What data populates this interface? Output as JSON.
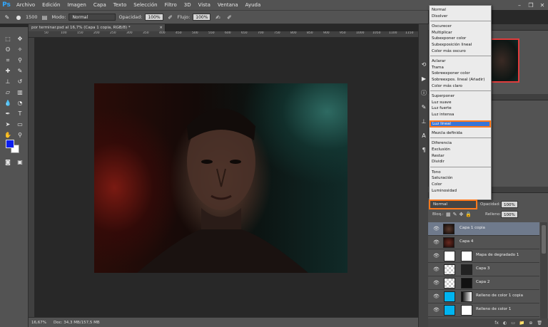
{
  "app": {
    "logo": "Ps"
  },
  "menu": [
    "Archivo",
    "Edición",
    "Imagen",
    "Capa",
    "Texto",
    "Selección",
    "Filtro",
    "3D",
    "Vista",
    "Ventana",
    "Ayuda"
  ],
  "window_controls": [
    "–",
    "❐",
    "✕"
  ],
  "options": {
    "brush_size": "1500",
    "mode_label": "Modo:",
    "mode_value": "Normal",
    "opacity_label": "Opacidad:",
    "opacity_value": "100%",
    "flow_label": "Flujo:",
    "flow_value": "100%"
  },
  "document": {
    "tab_title": "por terminar.psd al 16,7% (Capa 1 copia, RGB/8) *",
    "close": "×",
    "ruler_ticks": [
      "50",
      "100",
      "150",
      "200",
      "250",
      "300",
      "350",
      "400",
      "450",
      "500",
      "550",
      "600",
      "650",
      "700",
      "750",
      "800",
      "850",
      "900",
      "950",
      "1000",
      "1050",
      "1100",
      "1150"
    ]
  },
  "status": {
    "zoom": "16,67%",
    "doc": "Doc: 34,3 MB/157,5 MB"
  },
  "blend_menu": {
    "groups": [
      [
        "Normal",
        "Disolver"
      ],
      [
        "Oscurecer",
        "Multiplicar",
        "Subexponer color",
        "Subexposición lineal",
        "Color más oscuro"
      ],
      [
        "Aclarar",
        "Trama",
        "Sobreexponer color",
        "Sobreexpos. lineal (Añadir)",
        "Color más claro"
      ],
      [
        "Superponer",
        "Luz suave",
        "Luz fuerte",
        "Luz intensa",
        "Luz lineal",
        "Luz focal",
        "Mezcla definida"
      ],
      [
        "Diferencia",
        "Exclusión",
        "Restar",
        "Dividir"
      ],
      [
        "Tono",
        "Saturación",
        "Color",
        "Luminosidad"
      ]
    ],
    "highlighted": "Luz lineal"
  },
  "layers_panel": {
    "blend_mode": "Normal",
    "opacity_label": "Opacidad:",
    "opacity_value": "100%",
    "lock_label": "Bloq.:",
    "fill_label": "Relleno:",
    "fill_value": "100%",
    "layers": [
      {
        "name": "Capa 1 copia",
        "selected": true
      },
      {
        "name": "Capa 4",
        "selected": false
      },
      {
        "name": "Mapa de degradado 1",
        "selected": false
      },
      {
        "name": "Capa 3",
        "selected": false
      },
      {
        "name": "Capa 2",
        "selected": false
      },
      {
        "name": "Relleno de color 1 copia",
        "selected": false
      },
      {
        "name": "Relleno de color 1",
        "selected": false
      }
    ],
    "footer_icons": [
      "fx",
      "◐",
      "▭",
      "📁",
      "⊕",
      "🗑"
    ]
  },
  "colors": {
    "foreground": "#0a1ef0",
    "background": "#ffffff",
    "highlight": "#ff7a1e",
    "selection": "#3875d7",
    "nav_frame": "#e03c3c"
  }
}
